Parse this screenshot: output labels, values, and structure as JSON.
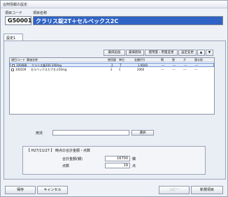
{
  "window": {
    "title": "合剤情報の設定"
  },
  "header": {
    "code_label": "項目コード",
    "name_label": "項目名称",
    "code_value": "G50001",
    "name_value": "クラリス錠2T＋セルベックス2C"
  },
  "tabs": [
    {
      "label": "設定1"
    }
  ],
  "toolbar": {
    "add": "薬価追加",
    "delete": "薬価削除",
    "change_use": "使用量・用量変更",
    "setting_change": "設定変更",
    "up": "▲",
    "down": "▼"
  },
  "table": {
    "columns": [
      "項目コード",
      "薬価名称",
      "使用量",
      "単位",
      "金額(円)",
      "朝",
      "昼",
      "夕",
      "寝る前"
    ],
    "rows": [
      {
        "code": "100088",
        "name": "クラリス錠200 200mg",
        "qty": "2",
        "unit": "T",
        "amount": "1.6640",
        "m": "---",
        "d": "---",
        "e": "---",
        "n": "---"
      },
      {
        "code": "100109",
        "name": "セルベックスカプセル50mg",
        "qty": "2",
        "unit": "C",
        "amount": "2060",
        "m": "---",
        "d": "---",
        "e": "---",
        "n": "---"
      }
    ]
  },
  "usage": {
    "label": "用法",
    "value": "",
    "select_label": "選択"
  },
  "summary": {
    "heading": "【 H27/11/27 】 時点の合計金額・点数",
    "total_label": "合計金額(銭)",
    "total_value": "16700",
    "total_unit": "銭",
    "points_label": "点数",
    "points_value": "19",
    "points_unit": "点"
  },
  "buttons": {
    "save": "保存",
    "cancel": "キャンセル",
    "copy": "コピー",
    "new_item": "新規項目"
  }
}
